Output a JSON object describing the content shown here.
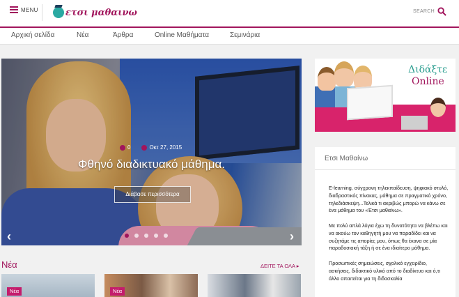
{
  "header": {
    "menu_label": "MENU",
    "logo_text": "ετσι μαθαινω",
    "search_label": "SEARCH"
  },
  "nav": {
    "items": [
      "Αρχική σελίδα",
      "Νέα",
      "Άρθρα",
      "Online Μαθήματα",
      "Σεμινάρια"
    ]
  },
  "hero": {
    "comments": "0",
    "date": "Οκτ 27, 2015",
    "title": "Φθηνό διαδικτυακό μάθημα.",
    "button_label": "Διάβασε περισσότερα",
    "prev_arrow": "‹",
    "next_arrow": "›",
    "slides": 5,
    "active_slide": 1
  },
  "ad": {
    "line1": "Διδάξτε",
    "line2": "Online"
  },
  "panel": {
    "title": "Ετσι Μαθαίνω",
    "paragraphs": [
      "E-learning, σύγχρονη τηλεκπαίδευση, ψηφιακό στυλό, διαδραστικός πίνακας, μάθημα σε πραγματικό χρόνο, τηλεδιάσκεψη...Τελικά τι ακριβώς μπορώ να κάνω σε ένα μάθημα του «Έτσι μαθαίνω».",
      "Με πολύ απλά λόγια έχω τη δυνατότητα να βλέπω και να ακούω τον καθηγητή μου να παραδίδει και να συζητάμε τις απορίες μου, όπως θα έκανα σε μία παραδοσιακή τάξη ή σε ένα ιδιαίτερο μάθημα.",
      "Προσωπικές σημειώσεις, σχολικό εγχειρίδιο, ασκήσεις, διδακτικό υλικό από το διαδίκτυο και ό,τι άλλο απαιτείται για τη διδασκαλία"
    ]
  },
  "news": {
    "heading": "Νέα",
    "see_all": "ΔΕΙΤΕ ΤΑ ΟΛΑ ▸",
    "cards": [
      {
        "badge": "Νέα"
      },
      {
        "badge": "Νέα"
      },
      {
        "badge": ""
      }
    ]
  },
  "colors": {
    "accent": "#a1155c",
    "ad_band": "#d8236b",
    "ad_teal": "#2a9d8f",
    "background": "#f1f1f1"
  }
}
